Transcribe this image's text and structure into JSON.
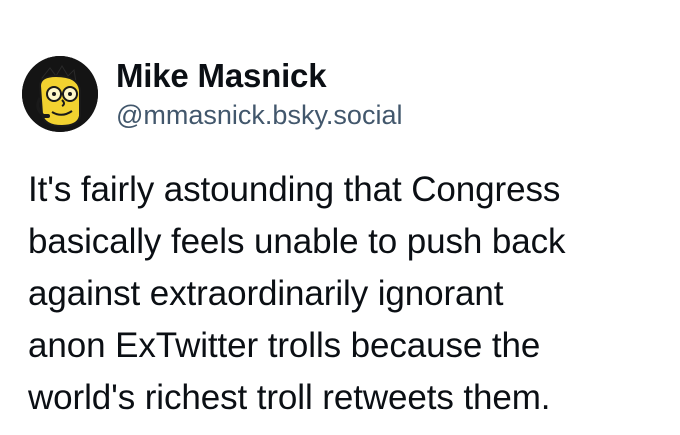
{
  "post": {
    "author": {
      "display_name": "Mike Masnick",
      "handle": "@mmasnick.bsky.social",
      "avatar_icon": "cartoon-avatar-icon"
    },
    "text": "It's fairly astounding that Congress\nbasically feels unable to push back\nagainst extraordinarily ignorant\nanon ExTwitter trolls because the\nworld's richest troll retweets them."
  },
  "colors": {
    "text": "#0b0f14",
    "handle": "#42576c",
    "background": "#ffffff",
    "avatar_bg": "#141414",
    "avatar_skin": "#f2d230"
  }
}
